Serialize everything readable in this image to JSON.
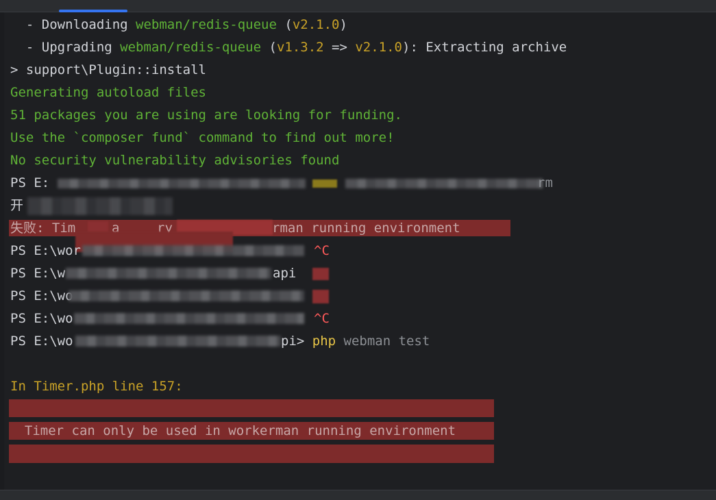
{
  "terminal": {
    "line1": {
      "prefix": "  - Downloading ",
      "pkg": "webman/redis-queue",
      "open": " (",
      "ver": "v2.1.0",
      "close": ")"
    },
    "line2": {
      "prefix": "  - Upgrading ",
      "pkg": "webman/redis-queue",
      "open": " (",
      "from": "v1.3.2",
      "arrow": " => ",
      "to": "v2.1.0",
      "rest": "): Extracting archive"
    },
    "line3": "> support\\Plugin::install",
    "line4": "Generating autoload files",
    "line5": "51 packages you are using are looking for funding.",
    "line6": "Use the `composer fund` command to find out more!",
    "line7": "No security vulnerability advisories found",
    "line8": {
      "prompt": "PS E:",
      "tail": "rm"
    },
    "line9": {
      "start": "开"
    },
    "line10": {
      "start": "失败: Tim",
      "mid1": "a",
      "mid2": "ry",
      "end": "rman running environment"
    },
    "line11": {
      "prompt": "PS E:\\wor",
      "tail": "^C"
    },
    "line12": {
      "prompt": "PS E:\\w",
      "tail": "api"
    },
    "line13": {
      "prompt": "PS E:\\wo"
    },
    "line14": {
      "prompt": "PS E:\\wo",
      "tail": "^C"
    },
    "line15": {
      "prompt": "PS E:\\wo",
      "pathtail": "pi> ",
      "cmd": "php",
      "args": " webman test"
    },
    "error_heading": "In Timer.php line 157:",
    "error_message": "  Timer can only be used in workerman running environment  "
  },
  "colors": {
    "background": "#1e1f22",
    "green": "#5fb236",
    "amber": "#c9a227",
    "error_bg": "#7e2b2b",
    "red": "#ff5a5a",
    "accent": "#3574f0"
  }
}
